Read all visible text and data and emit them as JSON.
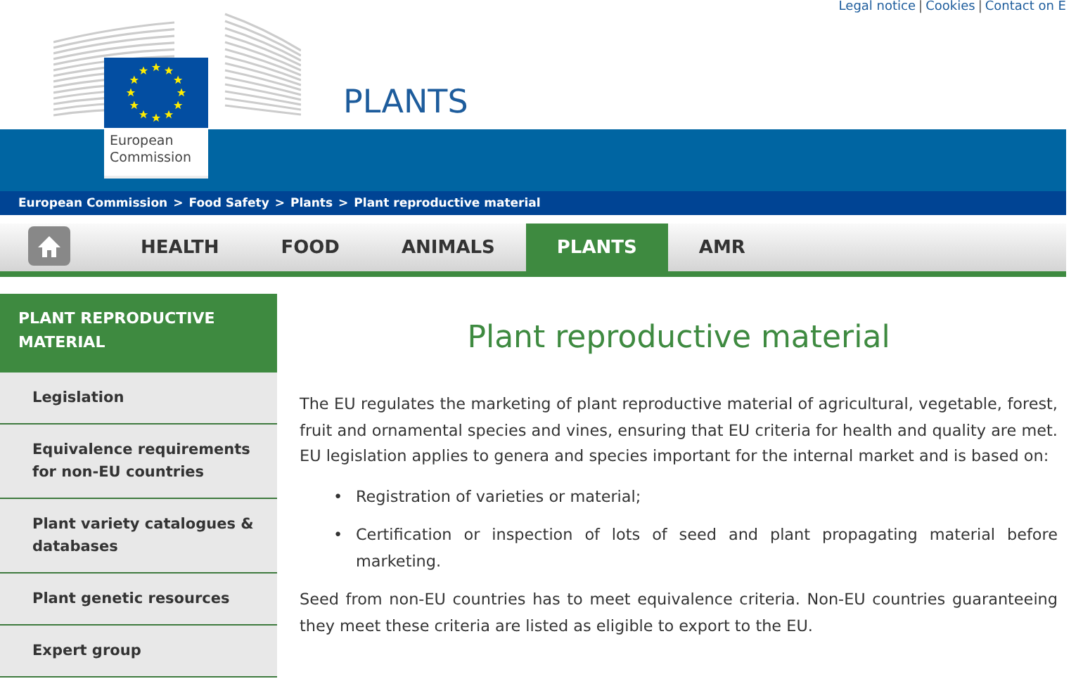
{
  "top_links": [
    "Legal notice",
    "Cookies",
    "Contact on E"
  ],
  "top_link_separator": "|",
  "breadcrumb_separator": ">",
  "logo": {
    "text": [
      "European",
      "Commission"
    ]
  },
  "site_title": "PLANTS",
  "breadcrumb": [
    "European Commission",
    "Food Safety",
    "Plants",
    "Plant reproductive material"
  ],
  "nav": {
    "items": [
      {
        "label": "HEALTH",
        "selected": false
      },
      {
        "label": "FOOD",
        "selected": false
      },
      {
        "label": "ANIMALS",
        "selected": false
      },
      {
        "label": "PLANTS",
        "selected": true
      },
      {
        "label": "AMR",
        "selected": false
      }
    ]
  },
  "sidebar": {
    "title": "PLANT REPRODUCTIVE MATERIAL",
    "items": [
      "Legislation",
      "Equivalence requirements for non-EU countries",
      "Plant variety catalogues & databases",
      "Plant genetic resources",
      "Expert group"
    ]
  },
  "content": {
    "heading": "Plant reproductive material",
    "intro": "The EU regulates the marketing of plant reproductive material of agricultural, vegetable, forest, fruit and ornamental species and vines, ensuring that EU criteria for health and quality are met. EU legislation applies to genera and species important for the internal market and is based on:",
    "bullet_marker": "•",
    "bullets": [
      "Registration of varieties or material;",
      "Certification or inspection of lots of seed and plant propagating material before marketing."
    ],
    "outro": "Seed from non-EU countries has to meet equivalence criteria. Non-EU countries guaranteeing they meet these criteria are listed as eligible to export to the EU."
  }
}
